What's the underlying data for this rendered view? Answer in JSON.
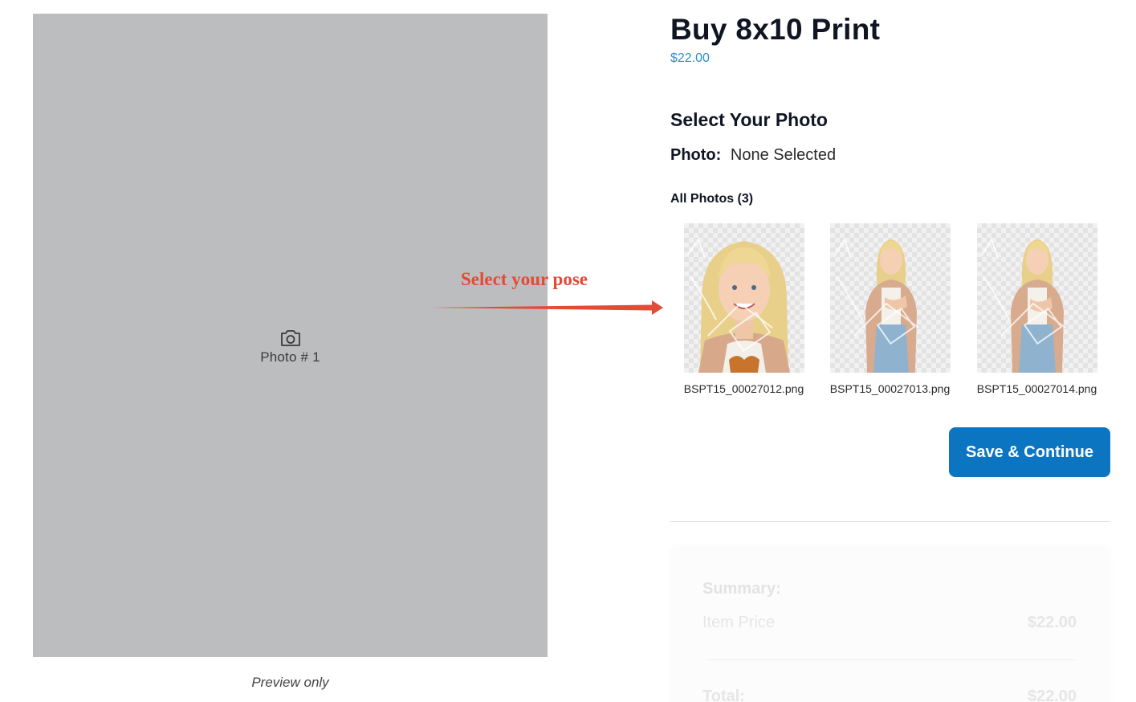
{
  "preview": {
    "photo_label": "Photo # 1",
    "caption": "Preview only",
    "camera_icon": "camera-icon"
  },
  "annotation": {
    "text": "Select your pose",
    "color": "#e24b37"
  },
  "product": {
    "title": "Buy 8x10 Print",
    "price": "$22.00"
  },
  "photo_select": {
    "section_title": "Select Your Photo",
    "label": "Photo:",
    "value": "None Selected",
    "all_photos_label": "All Photos (3)",
    "photos": [
      {
        "filename": "BSPT15_00027012.png",
        "pose": "close-up portrait"
      },
      {
        "filename": "BSPT15_00027013.png",
        "pose": "full body"
      },
      {
        "filename": "BSPT15_00027014.png",
        "pose": "full body"
      }
    ]
  },
  "actions": {
    "save_label": "Save & Continue",
    "accent_color": "#0c75c1"
  },
  "summary": {
    "title": "Summary:",
    "item_price_label": "Item Price",
    "item_price_value": "$22.00",
    "total_label": "Total:",
    "total_value": "$22.00"
  }
}
